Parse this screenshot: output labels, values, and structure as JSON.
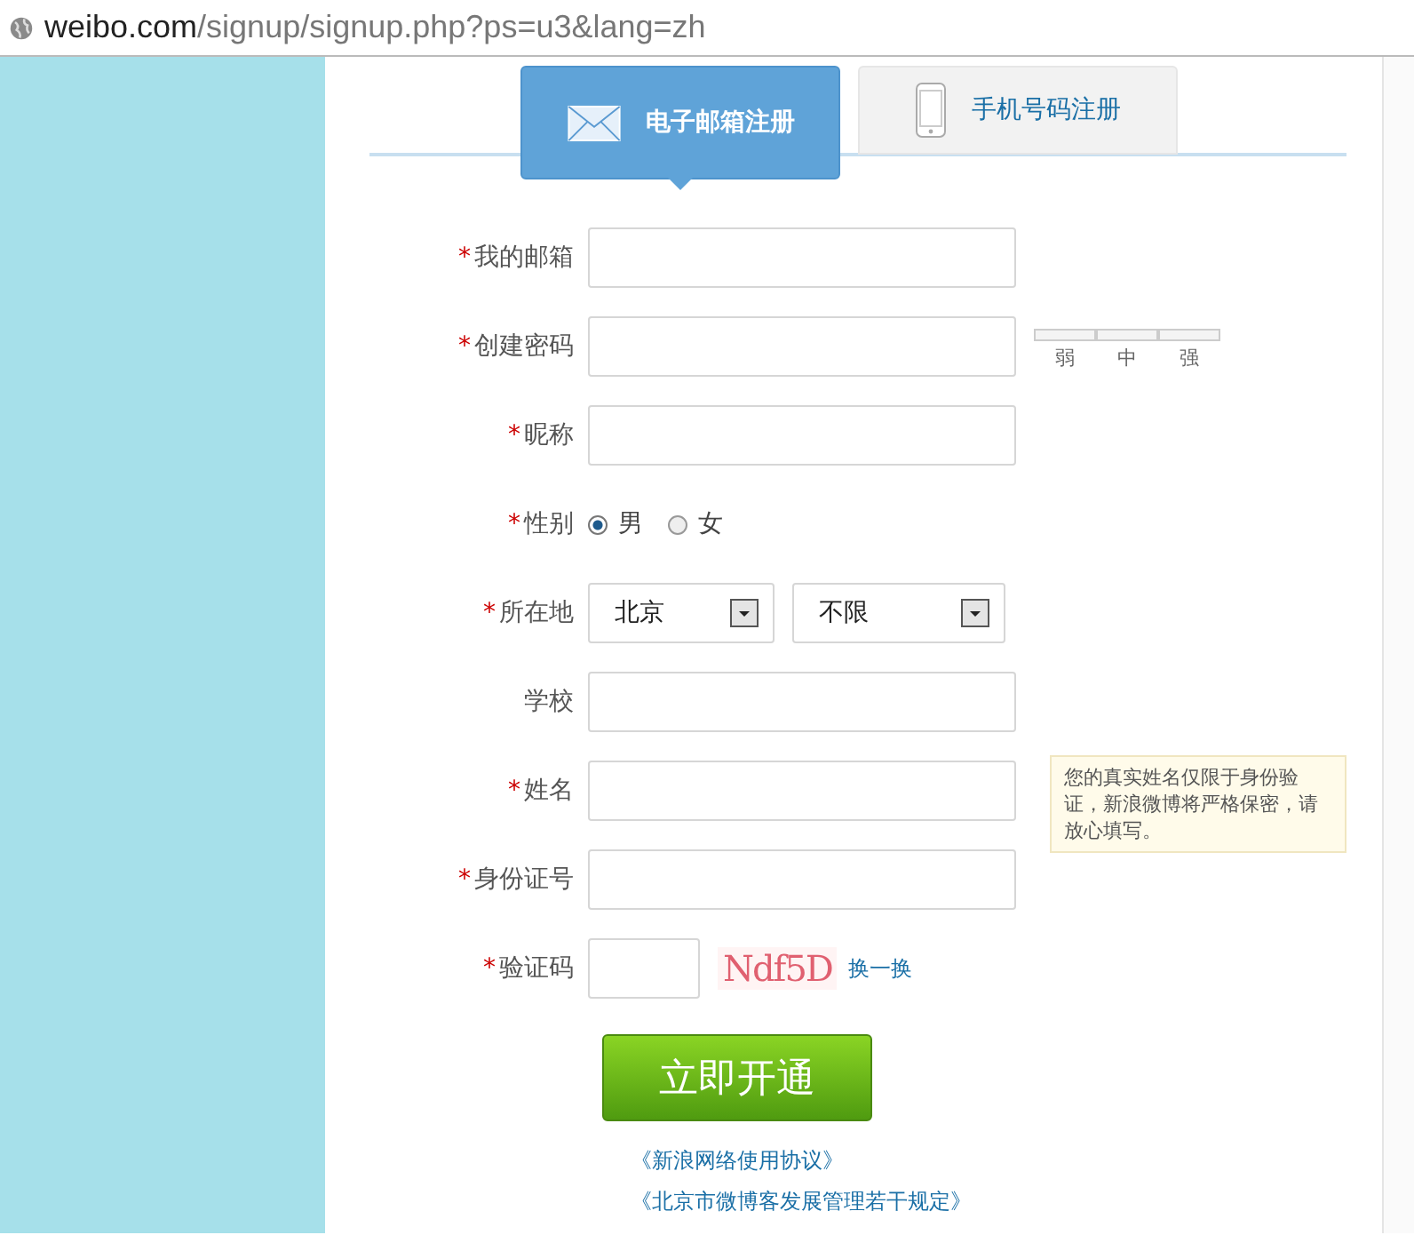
{
  "address_bar": {
    "url_host": "weibo.com",
    "url_path": "/signup/signup.php?ps=u3&lang=zh"
  },
  "tabs": [
    {
      "label": "电子邮箱注册",
      "kind": "email",
      "selected": true
    },
    {
      "label": "手机号码注册",
      "kind": "phone",
      "selected": false
    }
  ],
  "form": {
    "required_mark": "*",
    "fields": [
      {
        "kind": "text",
        "label": "我的邮箱",
        "required": true
      },
      {
        "kind": "password",
        "label": "创建密码",
        "required": true,
        "strength_labels": [
          "弱",
          "中",
          "强"
        ]
      },
      {
        "kind": "text",
        "label": "昵称",
        "required": true
      },
      {
        "kind": "radio",
        "label": "性别",
        "required": true,
        "options": [
          {
            "label": "男",
            "selected": true
          },
          {
            "label": "女",
            "selected": false
          }
        ]
      },
      {
        "kind": "select",
        "label": "所在地",
        "required": true,
        "selects": [
          {
            "value": "北京"
          },
          {
            "value": "不限"
          }
        ]
      },
      {
        "kind": "text",
        "label": "学校",
        "required": false
      },
      {
        "kind": "text",
        "label": "姓名",
        "required": true,
        "hint": "您的真实姓名仅限于身份验证，新浪微博将严格保密，请放心填写。"
      },
      {
        "kind": "text",
        "label": "身份证号",
        "required": true
      },
      {
        "kind": "captcha",
        "label": "验证码",
        "required": true,
        "captcha_text": "Ndf5D",
        "refresh_link": "换一换"
      }
    ],
    "submit": "立即开通",
    "links": [
      "《新浪网络使用协议》",
      "《北京市微博客发展管理若干规定》"
    ]
  }
}
